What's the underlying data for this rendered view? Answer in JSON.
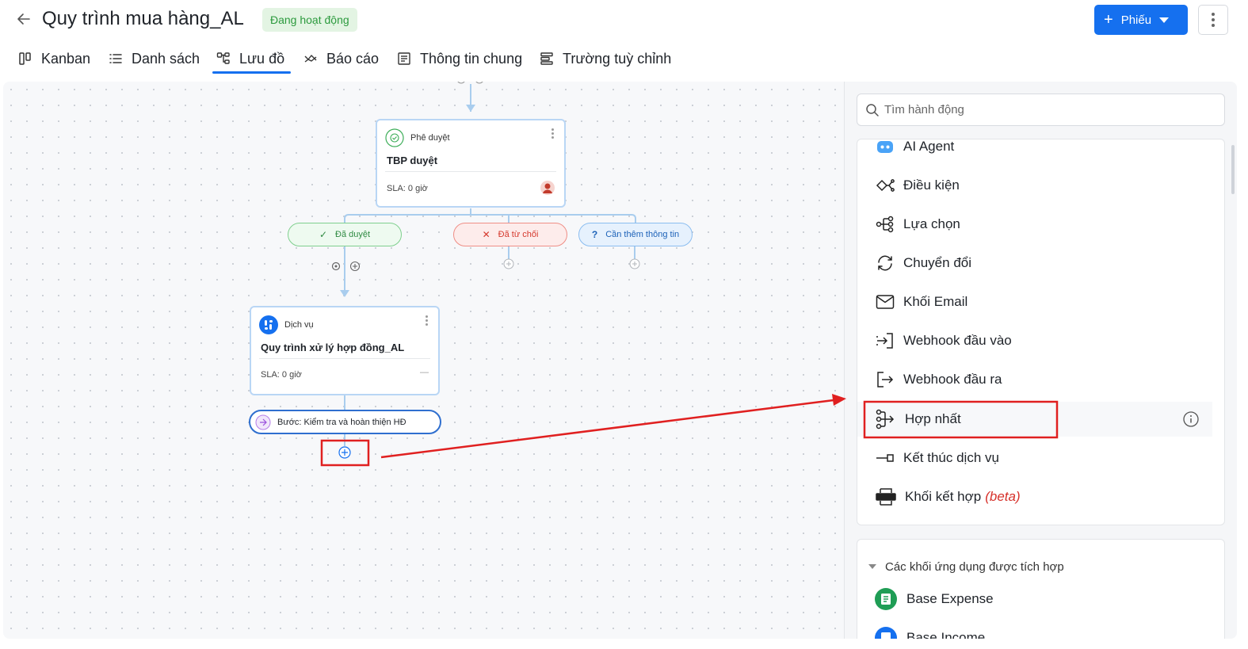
{
  "header": {
    "title": "Quy trình mua hàng_AL",
    "status": "Đang hoạt động",
    "new_button_label": "Phiếu"
  },
  "tabs": [
    {
      "label": "Kanban"
    },
    {
      "label": "Danh sách"
    },
    {
      "label": "Lưu đồ",
      "active": true
    },
    {
      "label": "Báo cáo"
    },
    {
      "label": "Thông tin chung"
    },
    {
      "label": "Trường tuỳ chỉnh"
    }
  ],
  "flow": {
    "approval_node": {
      "type": "Phê duyệt",
      "name": "TBP duyệt",
      "sla_label": "SLA:",
      "sla_value": "0 giờ"
    },
    "branches": {
      "approved": "Đã duyệt",
      "rejected": "Đã từ chối",
      "more_info": "Cần thêm thông tin"
    },
    "service_node": {
      "type": "Dịch vụ",
      "name": "Quy trình xử lý hợp đồng_AL",
      "sla_label": "SLA:",
      "sla_value": "0 giờ",
      "dash": "—"
    },
    "step": "Bước: Kiểm tra và hoàn thiện HĐ"
  },
  "panel": {
    "search_placeholder": "Tìm hành động",
    "actions": [
      {
        "label": "AI Agent",
        "icon": "ai-agent-icon"
      },
      {
        "label": "Điều kiện",
        "icon": "condition-icon"
      },
      {
        "label": "Lựa chọn",
        "icon": "choice-icon"
      },
      {
        "label": "Chuyển đổi",
        "icon": "convert-icon"
      },
      {
        "label": "Khối Email",
        "icon": "email-icon"
      },
      {
        "label": "Webhook đầu vào",
        "icon": "webhook-in-icon"
      },
      {
        "label": "Webhook đầu ra",
        "icon": "webhook-out-icon"
      },
      {
        "label": "Hợp nhất",
        "icon": "merge-icon",
        "highlighted": true
      },
      {
        "label": "Kết thúc dịch vụ",
        "icon": "end-service-icon"
      },
      {
        "label": "Khối kết hợp",
        "suffix": "(beta)",
        "icon": "combine-icon"
      }
    ],
    "integrated": {
      "title": "Các khối ứng dụng được tích hợp",
      "items": [
        {
          "label": "Base Expense",
          "color": "#1f9d55"
        },
        {
          "label": "Base Income",
          "color": "#1570ef"
        }
      ]
    }
  },
  "colors": {
    "accent": "#1570ef",
    "annotation": "#e02020",
    "status_green": "#2c9a3e"
  }
}
